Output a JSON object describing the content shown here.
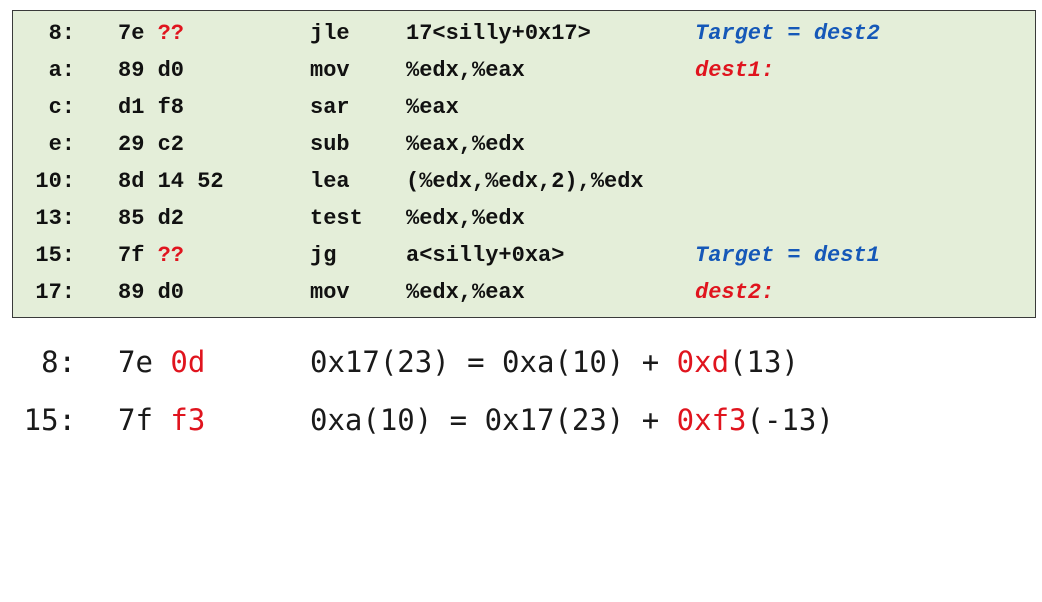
{
  "code": [
    {
      "addr": "8:",
      "bytes_black": "7e ",
      "bytes_red": "??",
      "op": "jle",
      "args": "17<silly+0x17>",
      "note": "Target = dest2",
      "note_color": "#1558b8"
    },
    {
      "addr": "a:",
      "bytes_black": "89 d0",
      "bytes_red": "",
      "op": "mov",
      "args": "%edx,%eax",
      "note": "dest1:",
      "note_color": "#e0141e"
    },
    {
      "addr": "c:",
      "bytes_black": "d1 f8",
      "bytes_red": "",
      "op": "sar",
      "args": "%eax",
      "note": "",
      "note_color": ""
    },
    {
      "addr": "e:",
      "bytes_black": "29 c2",
      "bytes_red": "",
      "op": "sub",
      "args": "%eax,%edx",
      "note": "",
      "note_color": ""
    },
    {
      "addr": "10:",
      "bytes_black": "8d 14 52",
      "bytes_red": "",
      "op": "lea",
      "args": "(%edx,%edx,2),%edx",
      "note": "",
      "note_color": ""
    },
    {
      "addr": "13:",
      "bytes_black": "85 d2",
      "bytes_red": "",
      "op": "test",
      "args": "%edx,%edx",
      "note": "",
      "note_color": ""
    },
    {
      "addr": "15:",
      "bytes_black": "7f ",
      "bytes_red": "??",
      "op": "jg",
      "args": "a<silly+0xa>",
      "note": "Target = dest1",
      "note_color": "#1558b8"
    },
    {
      "addr": "17:",
      "bytes_black": "89 d0",
      "bytes_red": "",
      "op": "mov",
      "args": "%edx,%eax",
      "note": "dest2:",
      "note_color": "#e0141e"
    }
  ],
  "calc": [
    {
      "addr": "8:",
      "opcode": "7e",
      "offset": "0d",
      "expr_lead": "0x17(23) = 0xa(10) + ",
      "expr_hl": "0xd",
      "expr_tail": "(13)"
    },
    {
      "addr": "15:",
      "opcode": "7f",
      "offset": "f3",
      "expr_lead": "0xa(10) = 0x17(23) + ",
      "expr_hl": "0xf3",
      "expr_tail": "(-13)"
    }
  ]
}
